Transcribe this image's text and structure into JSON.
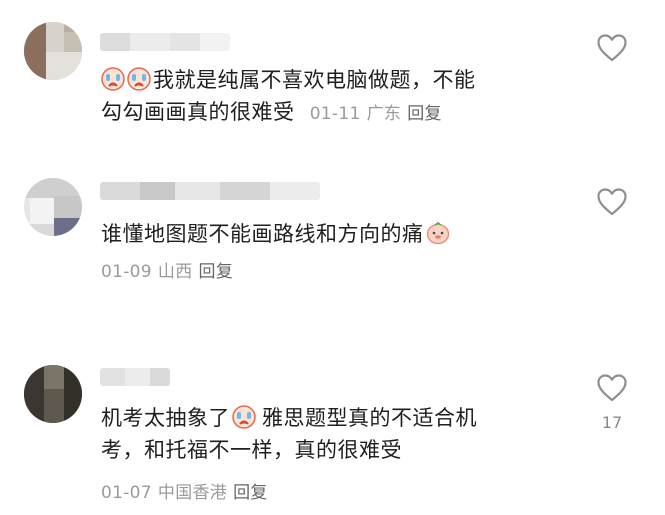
{
  "comments": [
    {
      "text_line1": "我就是纯属不喜欢电脑做题，不能",
      "text_line2": "勾勾画画真的很难受",
      "date": "01-11",
      "region": "广东",
      "reply_label": "回复",
      "like_count": "",
      "emojis": [
        "crying-face-emoji",
        "crying-face-emoji"
      ]
    },
    {
      "text_line1": "谁懂地图题不能画路线和方向的痛",
      "date": "01-09",
      "region": "山西",
      "reply_label": "回复",
      "like_count": "",
      "emojis": [
        "piglet-face-emoji"
      ]
    },
    {
      "text_line1_a": "机考太抽象了",
      "text_line1_b": "雅思题型真的不适合机",
      "text_line2": "考，和托福不一样，真的很难受",
      "date": "01-07",
      "region": "中国香港",
      "reply_label": "回复",
      "like_count": "17",
      "emojis": [
        "crying-face-emoji"
      ]
    }
  ],
  "icons": {
    "like": "heart-outline-icon"
  },
  "colors": {
    "text": "#1f1f1f",
    "meta": "#9a9a9a",
    "reply": "#666666",
    "icon": "#8f8f8f"
  }
}
